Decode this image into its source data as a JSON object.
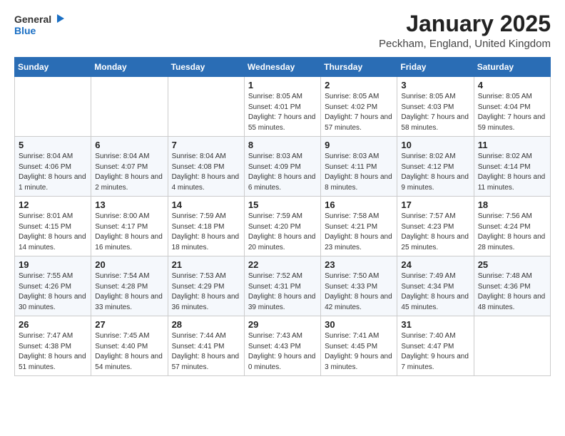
{
  "header": {
    "logo_general": "General",
    "logo_blue": "Blue",
    "title": "January 2025",
    "subtitle": "Peckham, England, United Kingdom"
  },
  "weekdays": [
    "Sunday",
    "Monday",
    "Tuesday",
    "Wednesday",
    "Thursday",
    "Friday",
    "Saturday"
  ],
  "weeks": [
    [
      {
        "day": "",
        "info": ""
      },
      {
        "day": "",
        "info": ""
      },
      {
        "day": "",
        "info": ""
      },
      {
        "day": "1",
        "info": "Sunrise: 8:05 AM\nSunset: 4:01 PM\nDaylight: 7 hours and 55 minutes."
      },
      {
        "day": "2",
        "info": "Sunrise: 8:05 AM\nSunset: 4:02 PM\nDaylight: 7 hours and 57 minutes."
      },
      {
        "day": "3",
        "info": "Sunrise: 8:05 AM\nSunset: 4:03 PM\nDaylight: 7 hours and 58 minutes."
      },
      {
        "day": "4",
        "info": "Sunrise: 8:05 AM\nSunset: 4:04 PM\nDaylight: 7 hours and 59 minutes."
      }
    ],
    [
      {
        "day": "5",
        "info": "Sunrise: 8:04 AM\nSunset: 4:06 PM\nDaylight: 8 hours and 1 minute."
      },
      {
        "day": "6",
        "info": "Sunrise: 8:04 AM\nSunset: 4:07 PM\nDaylight: 8 hours and 2 minutes."
      },
      {
        "day": "7",
        "info": "Sunrise: 8:04 AM\nSunset: 4:08 PM\nDaylight: 8 hours and 4 minutes."
      },
      {
        "day": "8",
        "info": "Sunrise: 8:03 AM\nSunset: 4:09 PM\nDaylight: 8 hours and 6 minutes."
      },
      {
        "day": "9",
        "info": "Sunrise: 8:03 AM\nSunset: 4:11 PM\nDaylight: 8 hours and 8 minutes."
      },
      {
        "day": "10",
        "info": "Sunrise: 8:02 AM\nSunset: 4:12 PM\nDaylight: 8 hours and 9 minutes."
      },
      {
        "day": "11",
        "info": "Sunrise: 8:02 AM\nSunset: 4:14 PM\nDaylight: 8 hours and 11 minutes."
      }
    ],
    [
      {
        "day": "12",
        "info": "Sunrise: 8:01 AM\nSunset: 4:15 PM\nDaylight: 8 hours and 14 minutes."
      },
      {
        "day": "13",
        "info": "Sunrise: 8:00 AM\nSunset: 4:17 PM\nDaylight: 8 hours and 16 minutes."
      },
      {
        "day": "14",
        "info": "Sunrise: 7:59 AM\nSunset: 4:18 PM\nDaylight: 8 hours and 18 minutes."
      },
      {
        "day": "15",
        "info": "Sunrise: 7:59 AM\nSunset: 4:20 PM\nDaylight: 8 hours and 20 minutes."
      },
      {
        "day": "16",
        "info": "Sunrise: 7:58 AM\nSunset: 4:21 PM\nDaylight: 8 hours and 23 minutes."
      },
      {
        "day": "17",
        "info": "Sunrise: 7:57 AM\nSunset: 4:23 PM\nDaylight: 8 hours and 25 minutes."
      },
      {
        "day": "18",
        "info": "Sunrise: 7:56 AM\nSunset: 4:24 PM\nDaylight: 8 hours and 28 minutes."
      }
    ],
    [
      {
        "day": "19",
        "info": "Sunrise: 7:55 AM\nSunset: 4:26 PM\nDaylight: 8 hours and 30 minutes."
      },
      {
        "day": "20",
        "info": "Sunrise: 7:54 AM\nSunset: 4:28 PM\nDaylight: 8 hours and 33 minutes."
      },
      {
        "day": "21",
        "info": "Sunrise: 7:53 AM\nSunset: 4:29 PM\nDaylight: 8 hours and 36 minutes."
      },
      {
        "day": "22",
        "info": "Sunrise: 7:52 AM\nSunset: 4:31 PM\nDaylight: 8 hours and 39 minutes."
      },
      {
        "day": "23",
        "info": "Sunrise: 7:50 AM\nSunset: 4:33 PM\nDaylight: 8 hours and 42 minutes."
      },
      {
        "day": "24",
        "info": "Sunrise: 7:49 AM\nSunset: 4:34 PM\nDaylight: 8 hours and 45 minutes."
      },
      {
        "day": "25",
        "info": "Sunrise: 7:48 AM\nSunset: 4:36 PM\nDaylight: 8 hours and 48 minutes."
      }
    ],
    [
      {
        "day": "26",
        "info": "Sunrise: 7:47 AM\nSunset: 4:38 PM\nDaylight: 8 hours and 51 minutes."
      },
      {
        "day": "27",
        "info": "Sunrise: 7:45 AM\nSunset: 4:40 PM\nDaylight: 8 hours and 54 minutes."
      },
      {
        "day": "28",
        "info": "Sunrise: 7:44 AM\nSunset: 4:41 PM\nDaylight: 8 hours and 57 minutes."
      },
      {
        "day": "29",
        "info": "Sunrise: 7:43 AM\nSunset: 4:43 PM\nDaylight: 9 hours and 0 minutes."
      },
      {
        "day": "30",
        "info": "Sunrise: 7:41 AM\nSunset: 4:45 PM\nDaylight: 9 hours and 3 minutes."
      },
      {
        "day": "31",
        "info": "Sunrise: 7:40 AM\nSunset: 4:47 PM\nDaylight: 9 hours and 7 minutes."
      },
      {
        "day": "",
        "info": ""
      }
    ]
  ]
}
